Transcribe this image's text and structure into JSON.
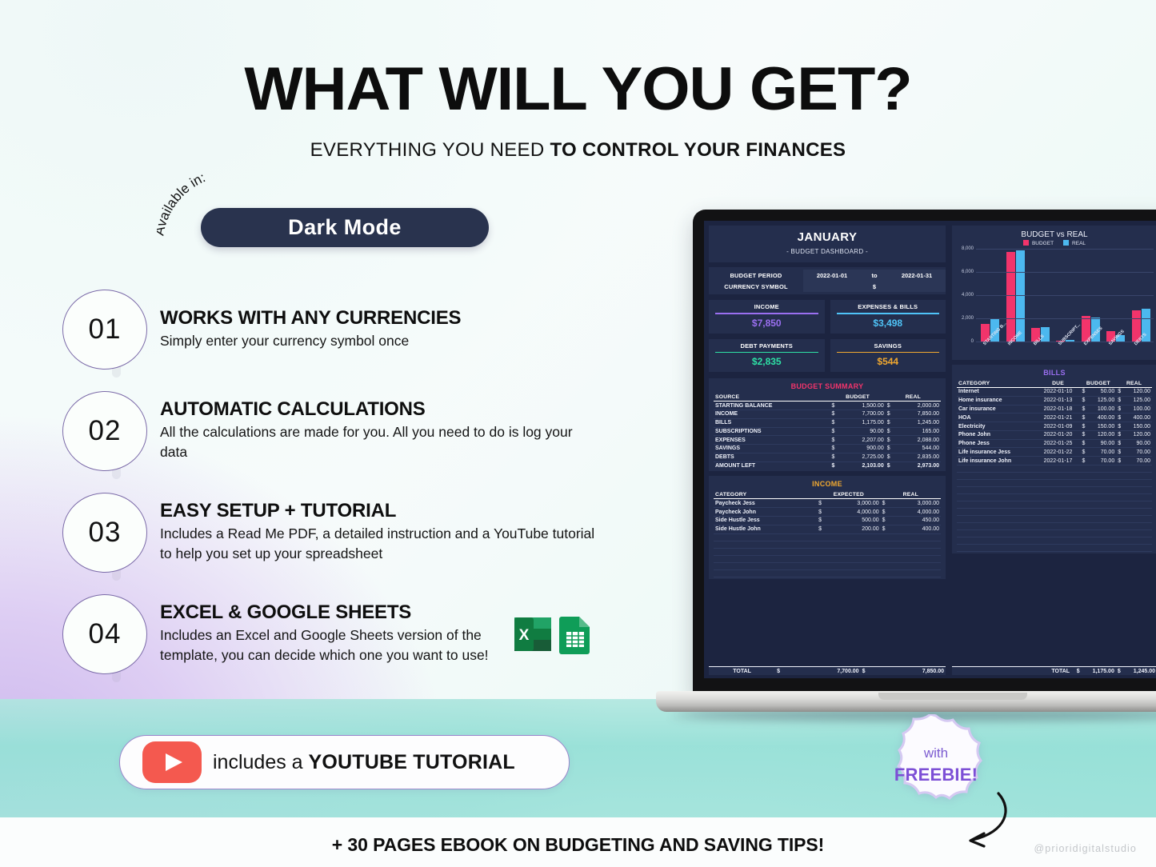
{
  "header": {
    "title": "WHAT WILL YOU GET?",
    "subtitle_normal": "EVERYTHING YOU NEED ",
    "subtitle_bold": "TO CONTROL YOUR FINANCES"
  },
  "available": {
    "arc_label": "Available in:",
    "mode_label": "Dark Mode"
  },
  "features": [
    {
      "number": "01",
      "title": "WORKS WITH ANY CURRENCIES",
      "desc": "Simply enter your currency symbol once"
    },
    {
      "number": "02",
      "title": "AUTOMATIC CALCULATIONS",
      "desc": "All the calculations are made for you. All you need to do is log your data"
    },
    {
      "number": "03",
      "title": "EASY SETUP + TUTORIAL",
      "desc": "Includes a Read Me PDF,  a detailed instruction and a YouTube tutorial to help you set up your spreadsheet"
    },
    {
      "number": "04",
      "title": "EXCEL & GOOGLE SHEETS",
      "desc": "Includes an Excel and Google Sheets version of the template, you can decide which one you want to use!"
    }
  ],
  "youtube": {
    "prefix": "includes a ",
    "bold": "YOUTUBE TUTORIAL"
  },
  "freebie": {
    "line1": "with",
    "line2": "FREEBIE!"
  },
  "footer": {
    "text": "+ 30 PAGES EBOOK ON BUDGETING AND SAVING TIPS!",
    "watermark": "@prioridigitalstudio"
  },
  "spreadsheet": {
    "month": "JANUARY",
    "subtitle": "- BUDGET DASHBOARD -",
    "period": {
      "label": "BUDGET PERIOD",
      "start": "2022-01-01",
      "to": "to",
      "end": "2022-01-31"
    },
    "currency": {
      "label": "CURRENCY SYMBOL",
      "value": "$"
    },
    "kpis": [
      {
        "label": "INCOME",
        "value": "$7,850",
        "color": "#9a6ff0"
      },
      {
        "label": "EXPENSES & BILLS",
        "value": "$3,498",
        "color": "#4fc3f7"
      },
      {
        "label": "DEBT PAYMENTS",
        "value": "$2,835",
        "color": "#2ee0a5"
      },
      {
        "label": "SAVINGS",
        "value": "$544",
        "color": "#f0a830"
      }
    ],
    "budget_summary": {
      "title": "BUDGET SUMMARY",
      "columns": [
        "SOURCE",
        "BUDGET",
        "REAL"
      ],
      "rows": [
        {
          "source": "STARTING BALANCE",
          "budget": "1,500.00",
          "real": "2,000.00"
        },
        {
          "source": "INCOME",
          "budget": "7,700.00",
          "real": "7,850.00"
        },
        {
          "source": "BILLS",
          "budget": "1,175.00",
          "real": "1,245.00"
        },
        {
          "source": "SUBSCRIPTIONS",
          "budget": "90.00",
          "real": "165.00"
        },
        {
          "source": "EXPENSES",
          "budget": "2,207.00",
          "real": "2,088.00"
        },
        {
          "source": "SAVINGS",
          "budget": "900.00",
          "real": "544.00"
        },
        {
          "source": "DEBTS",
          "budget": "2,725.00",
          "real": "2,835.00"
        }
      ],
      "total": {
        "source": "AMOUNT LEFT",
        "budget": "2,103.00",
        "real": "2,973.00"
      }
    },
    "income": {
      "title": "INCOME",
      "columns": [
        "CATEGORY",
        "EXPECTED",
        "REAL"
      ],
      "rows": [
        {
          "category": "Paycheck Jess",
          "expected": "3,000.00",
          "real": "3,000.00"
        },
        {
          "category": "Paycheck John",
          "expected": "4,000.00",
          "real": "4,000.00"
        },
        {
          "category": "Side Hustle Jess",
          "expected": "500.00",
          "real": "450.00"
        },
        {
          "category": "Side Hustle John",
          "expected": "200.00",
          "real": "400.00"
        }
      ],
      "total": {
        "label": "TOTAL",
        "expected": "7,700.00",
        "real": "7,850.00"
      }
    },
    "bills": {
      "title": "BILLS",
      "columns": [
        "CATEGORY",
        "DUE",
        "BUDGET",
        "REAL"
      ],
      "rows": [
        {
          "category": "Internet",
          "due": "2022-01-10",
          "budget": "50.00",
          "real": "120.00"
        },
        {
          "category": "Home insurance",
          "due": "2022-01-13",
          "budget": "125.00",
          "real": "125.00"
        },
        {
          "category": "Car insurance",
          "due": "2022-01-18",
          "budget": "100.00",
          "real": "100.00"
        },
        {
          "category": "HOA",
          "due": "2022-01-21",
          "budget": "400.00",
          "real": "400.00"
        },
        {
          "category": "Electricity",
          "due": "2022-01-09",
          "budget": "150.00",
          "real": "150.00"
        },
        {
          "category": "Phone John",
          "due": "2022-01-20",
          "budget": "120.00",
          "real": "120.00"
        },
        {
          "category": "Phone Jess",
          "due": "2022-01-25",
          "budget": "90.00",
          "real": "90.00"
        },
        {
          "category": "Life insurance Jess",
          "due": "2022-01-22",
          "budget": "70.00",
          "real": "70.00"
        },
        {
          "category": "Life insurance John",
          "due": "2022-01-17",
          "budget": "70.00",
          "real": "70.00"
        }
      ],
      "total": {
        "label": "TOTAL",
        "budget": "1,175.00",
        "real": "1,245.00"
      }
    }
  },
  "chart_data": {
    "type": "bar",
    "title": "BUDGET vs REAL",
    "categories": [
      "STARTING B...",
      "INCOME",
      "BILLS",
      "SUBSCRIPT...",
      "EXPENSES",
      "SAVINGS",
      "DEBTS"
    ],
    "series": [
      {
        "name": "BUDGET",
        "color": "#f2346b",
        "values": [
          1500,
          7700,
          1175,
          90,
          2207,
          900,
          2725
        ]
      },
      {
        "name": "REAL",
        "color": "#4cb8ef",
        "values": [
          2000,
          7850,
          1245,
          165,
          2088,
          544,
          2835
        ]
      }
    ],
    "ylim": [
      0,
      8000
    ],
    "yticks": [
      "8,000",
      "6,000",
      "4,000",
      "2,000",
      "0"
    ],
    "xlabel": "",
    "ylabel": "",
    "grid": true,
    "legend_position": "top"
  }
}
